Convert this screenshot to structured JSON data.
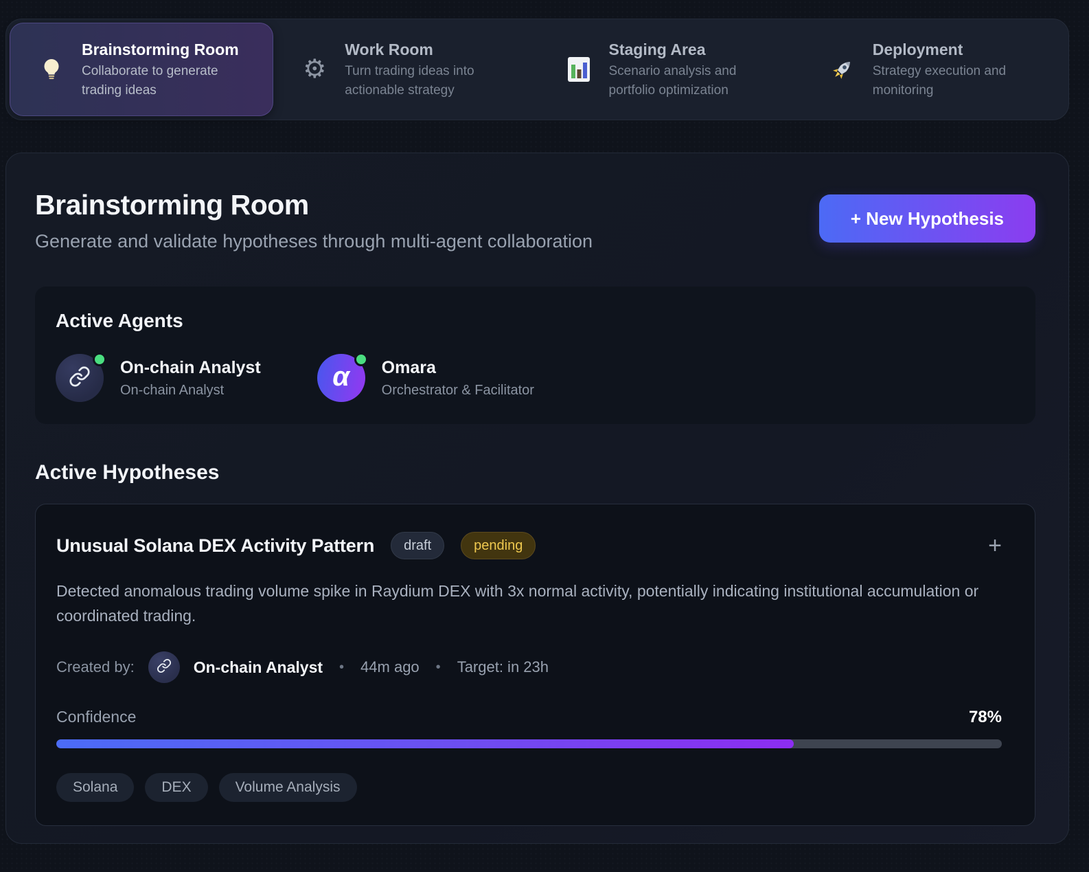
{
  "workflow_tabs": [
    {
      "label": "Brainstorming Room",
      "description": "Collaborate to generate trading ideas",
      "icon": "lightbulb-icon",
      "active": true
    },
    {
      "label": "Work Room",
      "description": "Turn trading ideas into actionable strategy",
      "icon": "gear-icon",
      "active": false
    },
    {
      "label": "Staging Area",
      "description": "Scenario analysis and portfolio optimization",
      "icon": "bar-chart-icon",
      "active": false
    },
    {
      "label": "Deployment",
      "description": "Strategy execution and monitoring",
      "icon": "rocket-icon",
      "active": false
    }
  ],
  "header": {
    "title": "Brainstorming Room",
    "subtitle": "Generate and validate hypotheses through multi-agent collaboration",
    "new_hypothesis_label": "+ New Hypothesis"
  },
  "active_agents": {
    "heading": "Active Agents",
    "agents": [
      {
        "name": "On-chain Analyst",
        "role": "On-chain Analyst",
        "avatar_icon": "chain-link-icon",
        "status": "online"
      },
      {
        "name": "Omara",
        "role": "Orchestrator & Facilitator",
        "avatar_glyph": "α",
        "status": "online"
      }
    ]
  },
  "hypotheses": {
    "heading": "Active Hypotheses",
    "items": [
      {
        "title": "Unusual Solana DEX Activity Pattern",
        "badges": [
          {
            "label": "draft",
            "type": "draft"
          },
          {
            "label": "pending",
            "type": "pending"
          }
        ],
        "expand_icon": "+",
        "description": "Detected anomalous trading volume spike in Raydium DEX with 3x normal activity, potentially indicating institutional accumulation or coordinated trading.",
        "created_by_label": "Created by:",
        "author": "On-chain Analyst",
        "author_avatar_icon": "chain-link-icon",
        "separator": "•",
        "time_ago": "44m ago",
        "target": "Target: in 23h",
        "confidence_label": "Confidence",
        "confidence_value": "78%",
        "confidence_percent": 78,
        "tags": [
          "Solana",
          "DEX",
          "Volume Analysis"
        ]
      }
    ]
  },
  "colors": {
    "accent_gradient_start": "#4c6af5",
    "accent_gradient_end": "#8b3df0",
    "status_online": "#4ade80",
    "pending_text": "#eec84f",
    "pending_bg": "#42350f"
  }
}
